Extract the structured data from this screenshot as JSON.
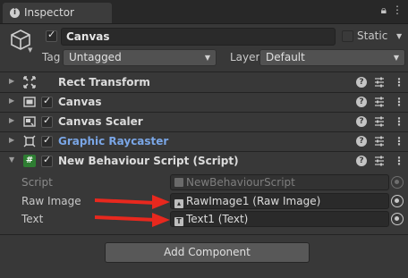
{
  "tab": {
    "title": "Inspector",
    "icon": "info-icon"
  },
  "window_controls": {
    "lock": "lock-icon",
    "more": "more-vertical-icon"
  },
  "header": {
    "active": true,
    "name": "Canvas",
    "static_label": "Static",
    "tag_label": "Tag",
    "tag_value": "Untagged",
    "layer_label": "Layer",
    "layer_value": "Default"
  },
  "components": [
    {
      "name": "Rect Transform",
      "has_checkbox": false,
      "icon": "rect-transform-icon"
    },
    {
      "name": "Canvas",
      "has_checkbox": true,
      "checked": true,
      "icon": "canvas-icon"
    },
    {
      "name": "Canvas Scaler",
      "has_checkbox": true,
      "checked": true,
      "icon": "canvas-scaler-icon"
    },
    {
      "name": "Graphic Raycaster",
      "has_checkbox": true,
      "checked": true,
      "icon": "graphic-raycaster-icon",
      "link_color": "#7aa6e6"
    },
    {
      "name": "New Behaviour Script (Script)",
      "has_checkbox": true,
      "checked": true,
      "icon": "csharp-script-icon",
      "expanded": true
    }
  ],
  "script_fields": [
    {
      "label": "Script",
      "value": "NewBehaviourScript",
      "disabled": true
    },
    {
      "label": "Raw Image",
      "value": "RawImage1 (Raw Image)"
    },
    {
      "label": "Text",
      "value": "Text1 (Text)"
    }
  ],
  "add_component_label": "Add Component",
  "colors": {
    "background": "#383838",
    "annotation_arrow": "#e8281e",
    "link": "#7aa6e6"
  }
}
